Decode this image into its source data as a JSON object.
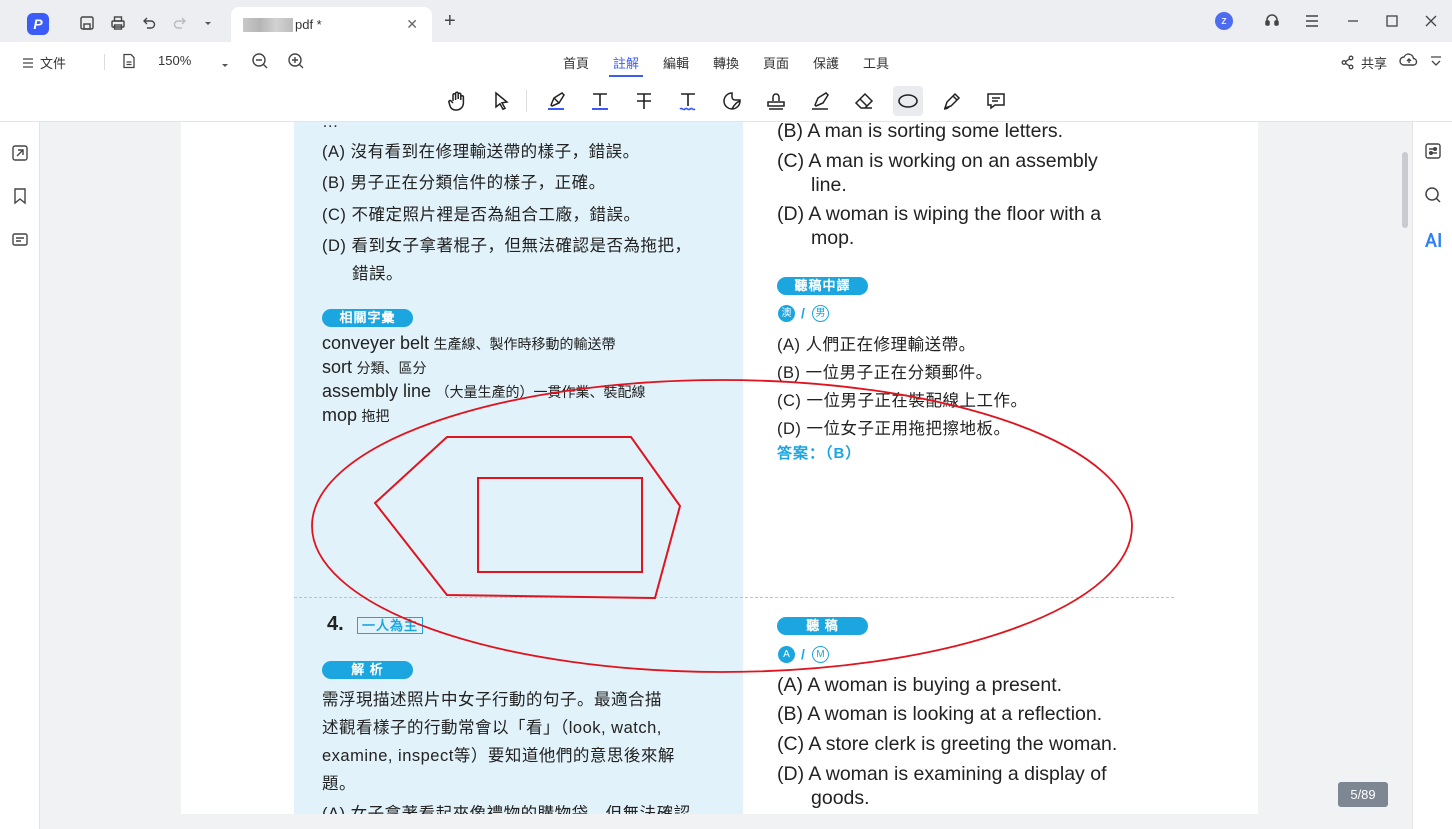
{
  "app": {
    "tab_title": "pdf *"
  },
  "titlebar": {
    "avatar": "z"
  },
  "menu": {
    "file": "文件",
    "zoom": "150%",
    "tabs": [
      "首頁",
      "註解",
      "編輯",
      "轉換",
      "頁面",
      "保護",
      "工具"
    ],
    "active_tab": "註解",
    "share": "共享"
  },
  "page": {
    "left": {
      "opt_a": "(A) 沒有看到在修理輸送帶的樣子，錯誤。",
      "opt_b": "(B) 男子正在分類信件的樣子，正確。",
      "opt_c": "(C) 不確定照片裡是否為組合工廠，錯誤。",
      "opt_d1": "(D) 看到女子拿著棍子，但無法確認是否為拖把，",
      "opt_d2": "錯誤。",
      "vocab_label": "相關字彙",
      "vocab": [
        {
          "en": "conveyer belt",
          "zh": "生產線、製作時移動的輸送帶"
        },
        {
          "en": "sort",
          "zh": "分類、區分"
        },
        {
          "en": "assembly line",
          "zh": "（大量生產的）一貫作業、裝配線"
        },
        {
          "en": "mop",
          "zh": "拖把"
        }
      ],
      "q_num": "4.",
      "q_tag": "一人為主",
      "analysis_label": "解 析",
      "analysis_1": "需浮現描述照片中女子行動的句子。最適合描",
      "analysis_2": "述觀看樣子的行動常會以「看」（look, watch,",
      "analysis_3": "examine, inspect等）要知道他們的意思後來解",
      "analysis_4": "題。",
      "analysis_5": "(A) 女子拿著看起來像禮物的購物袋，但無法確認"
    },
    "right": {
      "en_b": "(B) A man is sorting some letters.",
      "en_c1": "(C) A man is working on an assembly",
      "en_c2": "line.",
      "en_d1": "(D) A woman is wiping the floor with a",
      "en_d2": "mop.",
      "trans_label": "聽稿中譯",
      "accent_1": "澳",
      "accent_2": "男",
      "zh_a": "(A) 人們正在修理輸送帶。",
      "zh_b": "(B) 一位男子正在分類郵件。",
      "zh_c": "(C) 一位男子正在裝配線上工作。",
      "zh_d": "(D) 一位女子正用拖把擦地板。",
      "answer": "答案：（B）",
      "script_label": "聽 稿",
      "accent_3": "A",
      "accent_4": "M",
      "q4_a": "(A) A woman is buying a present.",
      "q4_b": "(B) A woman is looking at a reflection.",
      "q4_c": "(C) A store clerk is greeting the woman.",
      "q4_d1": "(D) A woman is examining a display of",
      "q4_d2": "goods."
    }
  },
  "annotation_color": "#e0141e",
  "accent_color": "#1ba6e0",
  "page_indicator": "5/89"
}
